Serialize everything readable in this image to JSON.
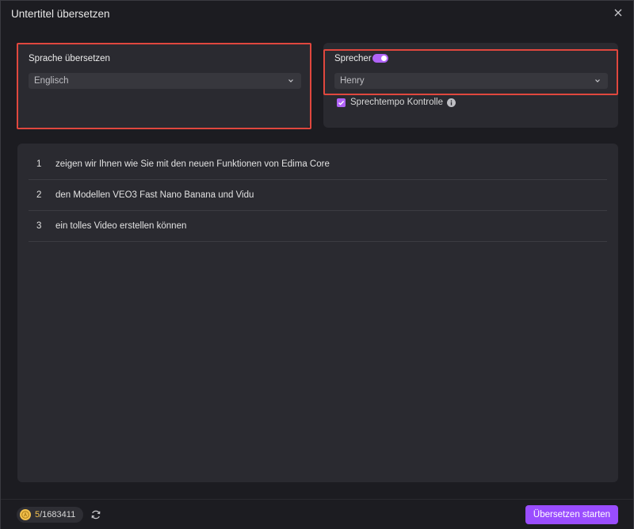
{
  "window": {
    "title": "Untertitel übersetzen"
  },
  "language_panel": {
    "label": "Sprache übersetzen",
    "selected": "Englisch"
  },
  "speaker_panel": {
    "label": "Sprecher",
    "toggle_on": true,
    "selected": "Henry",
    "speed_control_label": "Sprechtempo Kontrolle",
    "speed_control_checked": true
  },
  "subtitles": [
    {
      "index": "1",
      "text": "zeigen wir Ihnen  wie Sie mit den neuen Funktionen von Edima Core"
    },
    {
      "index": "2",
      "text": "den Modellen VEO3 Fast  Nano Banana und Vidu"
    },
    {
      "index": "3",
      "text": "ein tolles Video erstellen können"
    }
  ],
  "footer": {
    "credits_used": "5",
    "credits_total": "/1683411",
    "start_button": "Übersetzen starten"
  },
  "colors": {
    "accent": "#9a4dff",
    "highlight": "#e0473e",
    "coin": "#f2c14e"
  },
  "icons": {
    "close": "close-icon",
    "chevron": "chevron-down-icon",
    "info": "info-icon",
    "coin": "coin-icon",
    "refresh": "refresh-icon"
  }
}
